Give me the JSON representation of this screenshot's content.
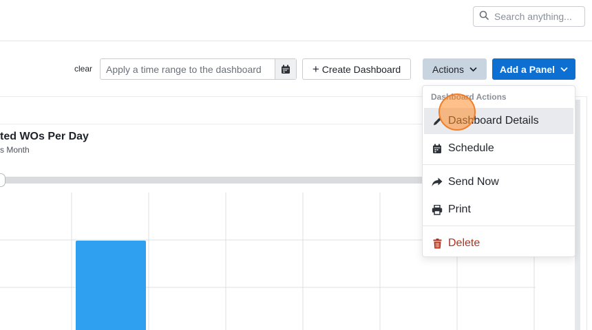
{
  "header": {
    "search_placeholder": "Search anything..."
  },
  "toolbar": {
    "clear_label": "clear",
    "time_range_placeholder": "Apply a time range to the dashboard",
    "create_dashboard_label": "Create Dashboard",
    "actions_label": "Actions",
    "add_panel_label": "Add a Panel"
  },
  "panel": {
    "title": "ted WOs Per Day",
    "subtitle": "s Month"
  },
  "dropdown": {
    "header": "Dashboard Actions",
    "items": [
      {
        "label": "Dashboard Details",
        "icon": "pencil-icon"
      },
      {
        "label": "Schedule",
        "icon": "calendar-icon"
      },
      {
        "label": "Send Now",
        "icon": "share-arrow-icon"
      },
      {
        "label": "Print",
        "icon": "printer-icon"
      },
      {
        "label": "Delete",
        "icon": "trash-icon"
      }
    ]
  },
  "colors": {
    "primary": "#0d6fd1",
    "actions_bg": "#c8d4e0",
    "bar": "#2f9ff0",
    "danger": "#b3311a",
    "cursor": "#ff8c28"
  },
  "chart_data": {
    "type": "bar",
    "categories": [
      "",
      "",
      "",
      "",
      "",
      "",
      ""
    ],
    "values": [
      null,
      1,
      null,
      null,
      null,
      null,
      null
    ],
    "title": "",
    "xlabel": "",
    "ylabel": "",
    "ylim": [
      0,
      2
    ],
    "grid": true
  }
}
